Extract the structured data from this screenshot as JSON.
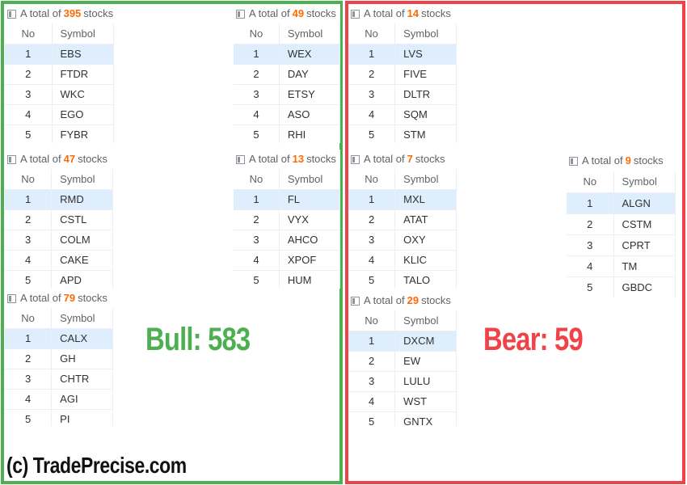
{
  "caption_prefix": "A total of",
  "caption_suffix": "stocks",
  "columns": {
    "no": "No",
    "symbol": "Symbol"
  },
  "colors": {
    "bull": "#4caf50",
    "bear": "#ef4349",
    "count": "#ff6a00",
    "highlight_row": "#dfeefd"
  },
  "bull": {
    "label": "Bull: 583",
    "panels": [
      {
        "count": "395",
        "rows": [
          [
            "1",
            "EBS"
          ],
          [
            "2",
            "FTDR"
          ],
          [
            "3",
            "WKC"
          ],
          [
            "4",
            "EGO"
          ],
          [
            "5",
            "FYBR"
          ]
        ]
      },
      {
        "count": "49",
        "rows": [
          [
            "1",
            "WEX"
          ],
          [
            "2",
            "DAY"
          ],
          [
            "3",
            "ETSY"
          ],
          [
            "4",
            "ASO"
          ],
          [
            "5",
            "RHI"
          ]
        ]
      },
      {
        "count": "47",
        "rows": [
          [
            "1",
            "RMD"
          ],
          [
            "2",
            "CSTL"
          ],
          [
            "3",
            "COLM"
          ],
          [
            "4",
            "CAKE"
          ],
          [
            "5",
            "APD"
          ]
        ]
      },
      {
        "count": "13",
        "rows": [
          [
            "1",
            "FL"
          ],
          [
            "2",
            "VYX"
          ],
          [
            "3",
            "AHCO"
          ],
          [
            "4",
            "XPOF"
          ],
          [
            "5",
            "HUM"
          ]
        ]
      },
      {
        "count": "79",
        "rows": [
          [
            "1",
            "CALX"
          ],
          [
            "2",
            "GH"
          ],
          [
            "3",
            "CHTR"
          ],
          [
            "4",
            "AGI"
          ],
          [
            "5",
            "PI"
          ]
        ]
      }
    ]
  },
  "bear": {
    "label": "Bear: 59",
    "panels": [
      {
        "count": "14",
        "rows": [
          [
            "1",
            "LVS"
          ],
          [
            "2",
            "FIVE"
          ],
          [
            "3",
            "DLTR"
          ],
          [
            "4",
            "SQM"
          ],
          [
            "5",
            "STM"
          ]
        ]
      },
      {
        "count": "7",
        "rows": [
          [
            "1",
            "MXL"
          ],
          [
            "2",
            "ATAT"
          ],
          [
            "3",
            "OXY"
          ],
          [
            "4",
            "KLIC"
          ],
          [
            "5",
            "TALO"
          ]
        ]
      },
      {
        "count": "9",
        "rows": [
          [
            "1",
            "ALGN"
          ],
          [
            "2",
            "CSTM"
          ],
          [
            "3",
            "CPRT"
          ],
          [
            "4",
            "TM"
          ],
          [
            "5",
            "GBDC"
          ]
        ]
      },
      {
        "count": "29",
        "rows": [
          [
            "1",
            "DXCM"
          ],
          [
            "2",
            "EW"
          ],
          [
            "3",
            "LULU"
          ],
          [
            "4",
            "WST"
          ],
          [
            "5",
            "GNTX"
          ]
        ]
      }
    ]
  },
  "credit": "(c) TradePrecise.com"
}
